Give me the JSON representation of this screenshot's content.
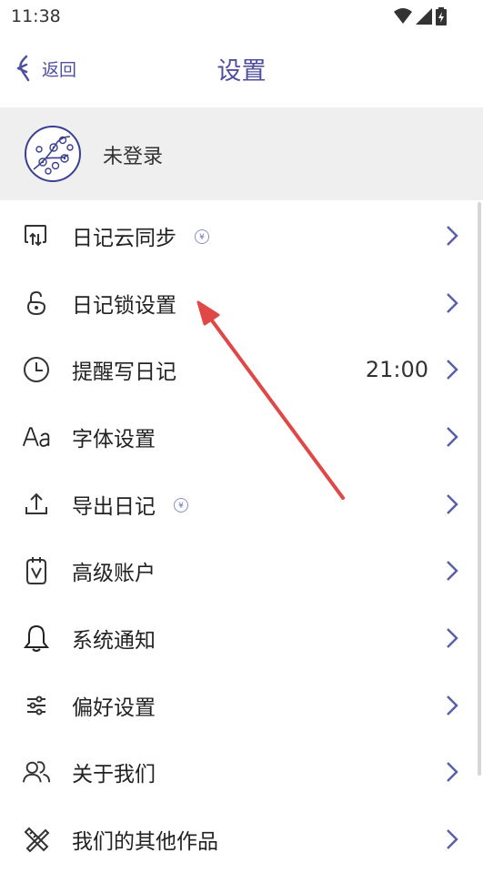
{
  "status_bar": {
    "time": "11:38"
  },
  "nav": {
    "back_label": "返回",
    "title": "设置"
  },
  "profile": {
    "login_status": "未登录"
  },
  "menu": [
    {
      "label": "日记云同步",
      "icon": "cloud-sync-icon",
      "vip": true,
      "value": ""
    },
    {
      "label": "日记锁设置",
      "icon": "lock-icon",
      "vip": false,
      "value": ""
    },
    {
      "label": "提醒写日记",
      "icon": "clock-icon",
      "vip": false,
      "value": "21:00"
    },
    {
      "label": "字体设置",
      "icon": "font-icon",
      "vip": false,
      "value": ""
    },
    {
      "label": "导出日记",
      "icon": "export-icon",
      "vip": true,
      "value": ""
    },
    {
      "label": "高级账户",
      "icon": "premium-account-icon",
      "vip": false,
      "value": ""
    },
    {
      "label": "系统通知",
      "icon": "bell-icon",
      "vip": false,
      "value": ""
    },
    {
      "label": "偏好设置",
      "icon": "sliders-icon",
      "vip": false,
      "value": ""
    },
    {
      "label": "关于我们",
      "icon": "people-icon",
      "vip": false,
      "value": ""
    },
    {
      "label": "我们的其他作品",
      "icon": "tools-icon",
      "vip": false,
      "value": ""
    }
  ],
  "vip_badge_symbol": "¥",
  "colors": {
    "accent": "#4f4fa0",
    "profile_bg": "#efefef",
    "chevron": "#5a5fa8",
    "annotation_arrow": "#e04848"
  }
}
